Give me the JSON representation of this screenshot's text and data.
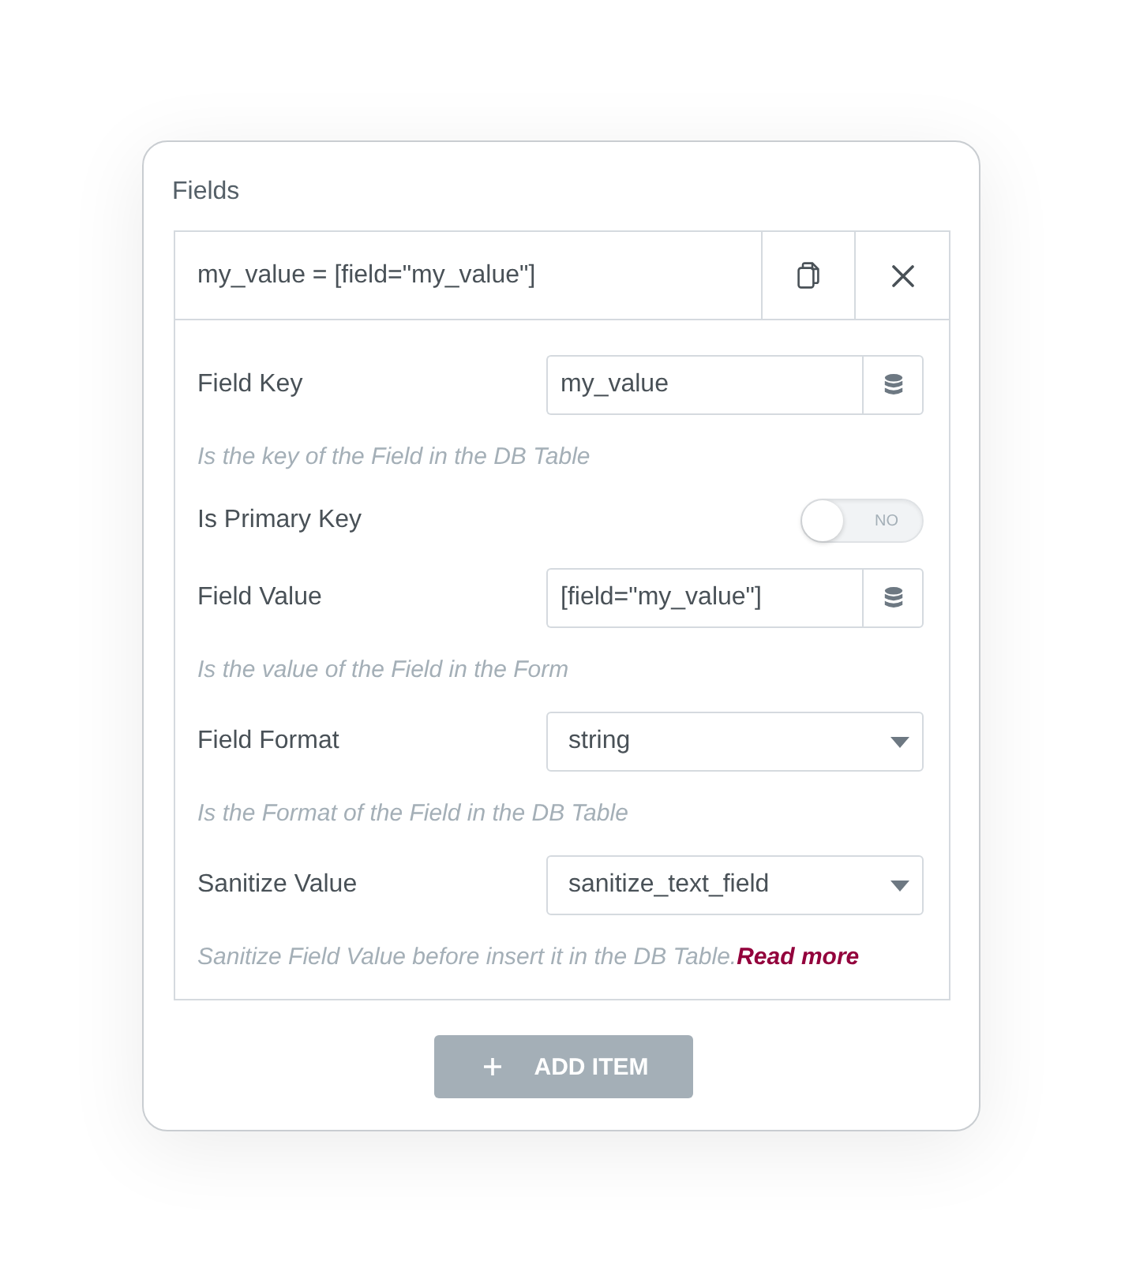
{
  "section": {
    "title": "Fields"
  },
  "items": [
    {
      "title": "my_value = [field=\"my_value\"]",
      "controls": [
        {
          "kind": "text",
          "label": "Field Key",
          "value": "my_value",
          "description": "Is the key of the Field in the DB Table"
        },
        {
          "kind": "switch",
          "label": "Is Primary Key",
          "on": false,
          "switch_text": "NO"
        },
        {
          "kind": "text",
          "label": "Field Value",
          "value": "[field=\"my_value\"]",
          "description": "Is the value of the Field in the Form"
        },
        {
          "kind": "select",
          "label": "Field Format",
          "value": "string",
          "description": "Is the Format of the Field in the DB Table"
        },
        {
          "kind": "select",
          "label": "Sanitize Value",
          "value": "sanitize_text_field",
          "description": "Sanitize Field Value before insert it in the DB Table.",
          "link": "Read more"
        }
      ]
    }
  ],
  "add_button": {
    "label": "ADD ITEM"
  }
}
